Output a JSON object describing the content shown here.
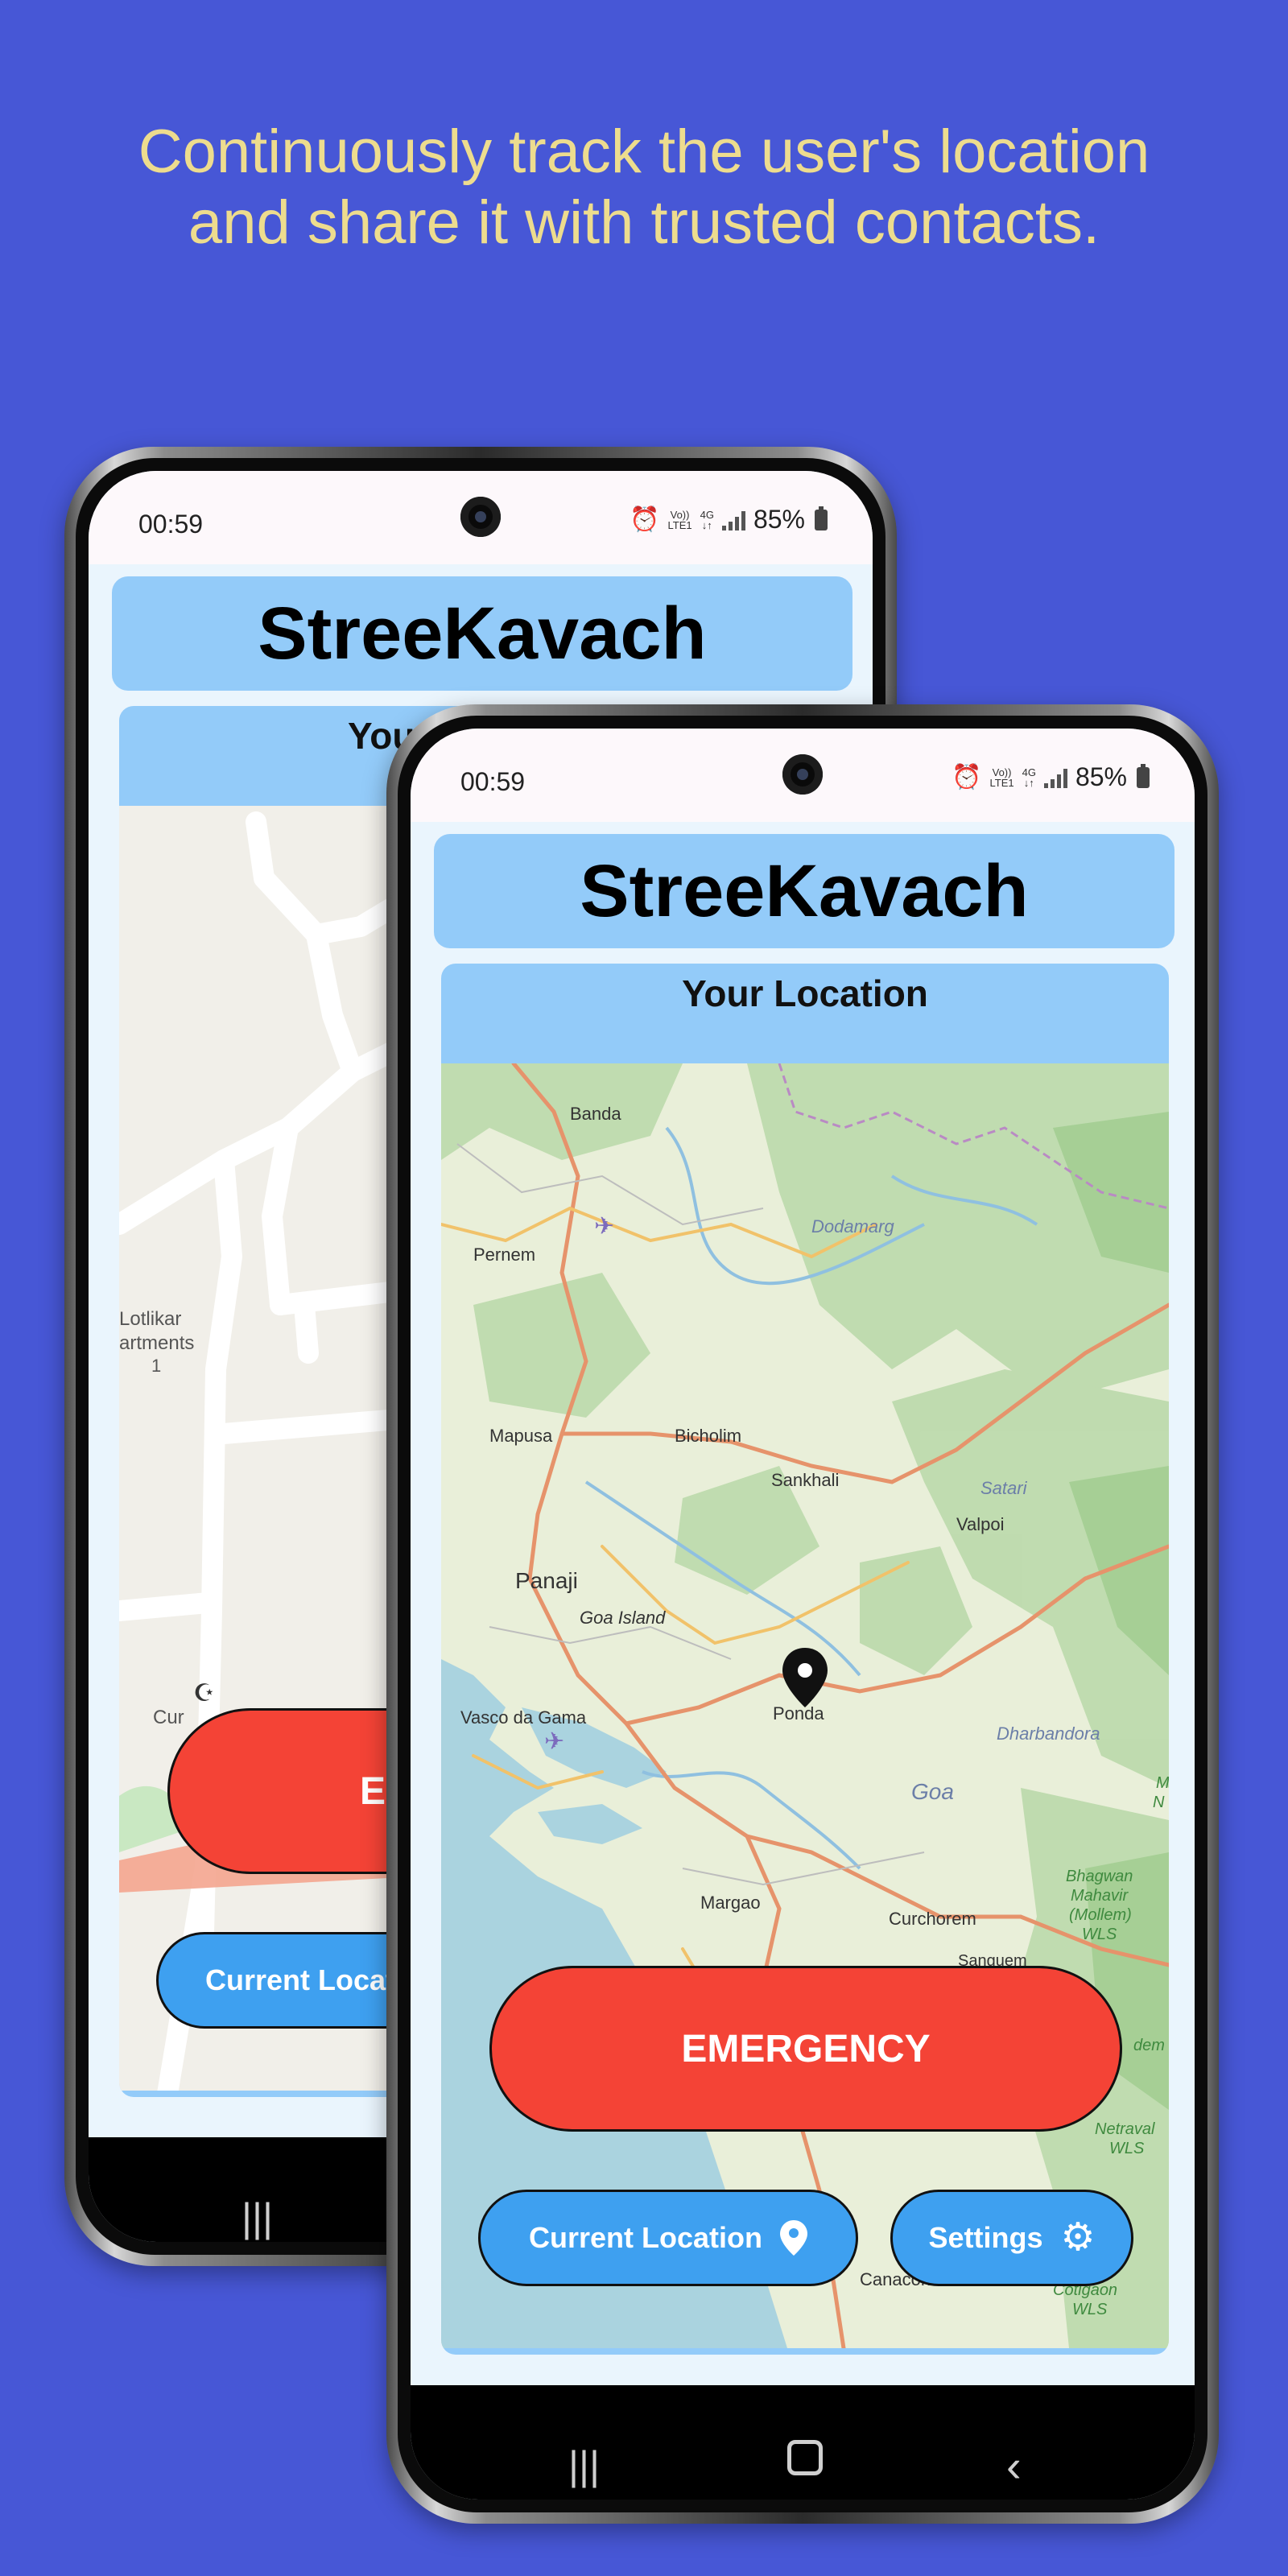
{
  "headline": "Continuously track the user's location and share it with trusted contacts.",
  "status_bar": {
    "time": "00:59",
    "volte_top": "Vo))",
    "volte_bottom": "LTE1",
    "network_top": "4G",
    "network_bottom": "↓↑",
    "battery": "85%"
  },
  "app": {
    "title": "StreeKavach",
    "map_card_title": "Your Location",
    "emergency_button": "EMERGENCY",
    "current_location_button": "Current Location",
    "settings_button": "Settings"
  },
  "back_phone": {
    "card_title_partial": "Your",
    "emergency_partial": "EI",
    "current_location_partial": "Current Locat",
    "map_labels": {
      "apartments_line1": "Lotlikar",
      "apartments_line2": "artments",
      "apartments_line3": "1",
      "place_partial": "Cur"
    }
  },
  "map_labels": {
    "banda": "Banda",
    "dodamarg": "Dodamarg",
    "pernem": "Pernem",
    "mapusa": "Mapusa",
    "bicholim": "Bicholim",
    "sankhali": "Sankhali",
    "satari": "Satari",
    "valpoi": "Valpoi",
    "panaji": "Panaji",
    "goa_island": "Goa Island",
    "vasco_da_gama": "Vasco da Gama",
    "ponda": "Ponda",
    "dharbandora": "Dharbandora",
    "goa": "Goa",
    "margao": "Margao",
    "curchorem": "Curchorem",
    "sanguem": "Sanguem",
    "bhagwan_1": "Bhagwan",
    "bhagwan_2": "Mahavir",
    "bhagwan_3": "(Mollem)",
    "bhagwan_4": "WLS",
    "netravali_1": "Netraval",
    "netravali_2": "WLS",
    "canacona": "Canacona",
    "cotigao_1": "Cotigaon",
    "cotigao_2": "WLS",
    "partial_m": "M",
    "partial_n": "N",
    "partial_dem": "dem"
  }
}
